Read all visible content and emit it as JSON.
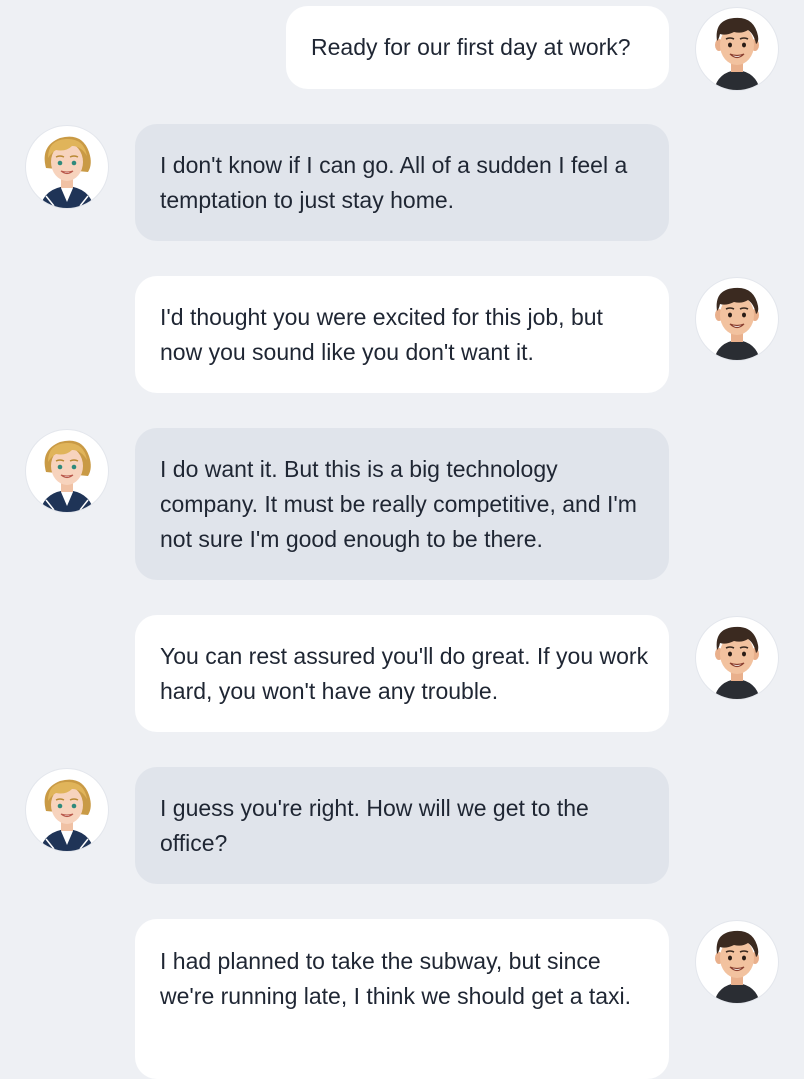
{
  "chat": {
    "messages": [
      {
        "sender": "boy",
        "side": "right",
        "text": "Ready for our first day at work?"
      },
      {
        "sender": "girl",
        "side": "left",
        "text": "I don't know if I can go. All of a sudden I feel a temptation to just stay home."
      },
      {
        "sender": "boy",
        "side": "right",
        "text": "I'd thought you were excited for this job, but now you sound like you don't want it."
      },
      {
        "sender": "girl",
        "side": "left",
        "text": "I do want it. But this is a big technology company. It must be really competitive, and I'm not sure I'm good enough to be there."
      },
      {
        "sender": "boy",
        "side": "right",
        "text": "You can rest assured you'll do great. If you work hard, you won't have any trouble."
      },
      {
        "sender": "girl",
        "side": "left",
        "text": "I guess you're right. How will we get to the office?"
      },
      {
        "sender": "boy",
        "side": "right",
        "text": "I had planned to take the subway, but since we're running late, I think we should get a taxi."
      }
    ]
  },
  "colors": {
    "background": "#eef0f4",
    "outgoing_bubble": "#ffffff",
    "incoming_bubble": "#e0e4eb",
    "text": "#1f2633"
  },
  "icons": {
    "boy_avatar": "boy-avatar-icon",
    "girl_avatar": "girl-avatar-icon"
  }
}
